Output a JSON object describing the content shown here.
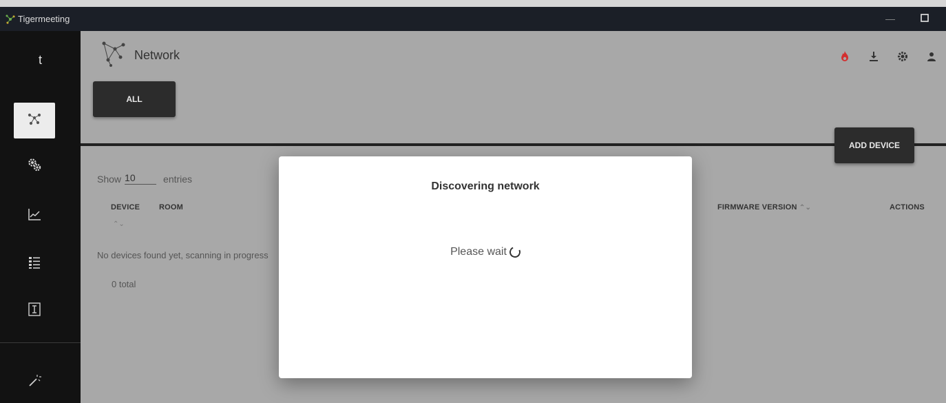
{
  "window": {
    "title": "Tigermeeting",
    "minimize_glyph": "—"
  },
  "sidebar": {
    "top_letter": "t",
    "items": [
      {
        "icon": "network-icon",
        "active": true
      },
      {
        "icon": "gears-icon",
        "active": false
      },
      {
        "icon": "chart-icon",
        "active": false
      },
      {
        "icon": "list-icon",
        "active": false
      },
      {
        "icon": "text-cursor-icon",
        "active": false
      },
      {
        "icon": "magic-wand-icon",
        "active": false
      }
    ]
  },
  "header": {
    "title": "Network",
    "icons": [
      "fire-icon",
      "download-icon",
      "settings-icon",
      "user-icon"
    ],
    "fire_color": "#d32f2f"
  },
  "filters": {
    "all_label": "ALL"
  },
  "actions": {
    "add_device_label": "ADD DEVICE"
  },
  "table": {
    "show_label": "Show",
    "entries_value": "10",
    "entries_label": "entries",
    "columns": [
      "DEVICE",
      "ROOM",
      "FIRMWARE VERSION",
      "ACTIONS"
    ],
    "sort_glyph": "⌃⌄",
    "empty_message": "No devices found yet, scanning in progress",
    "total_label": "0 total"
  },
  "modal": {
    "title": "Discovering network",
    "body": "Please wait"
  }
}
